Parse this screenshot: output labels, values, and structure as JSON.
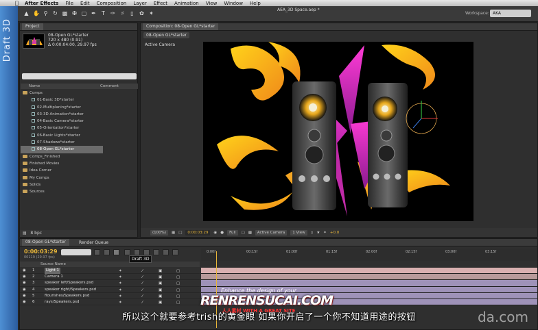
{
  "menubar": {
    "items": [
      "After Effects",
      "File",
      "Edit",
      "Composition",
      "Layer",
      "Effect",
      "Animation",
      "View",
      "Window",
      "Help"
    ]
  },
  "side_strip": {
    "label": "Draft 3D"
  },
  "toolbar": {
    "file_title": "AEA_3D Space.aep *",
    "workspace_label": "Workspace:",
    "workspace_value": "AKA"
  },
  "project": {
    "tab_label": "Project",
    "comp_name": "08-Open GL*starter",
    "info_lines": [
      "720 x 480 (0.91)",
      "Δ 0:00:04:00, 29.97 fps"
    ],
    "col_name": "Name",
    "col_comment": "Comment",
    "tree": [
      {
        "label": "Comps",
        "kind": "folder"
      },
      {
        "label": "01-Basic 3D*starter",
        "kind": "comp"
      },
      {
        "label": "02-Multiplaning*starter",
        "kind": "comp"
      },
      {
        "label": "03-3D Animation*starter",
        "kind": "comp"
      },
      {
        "label": "04-Basic Camera*starter",
        "kind": "comp"
      },
      {
        "label": "05-Orientation*starter",
        "kind": "comp"
      },
      {
        "label": "06-Basic Lights*starter",
        "kind": "comp"
      },
      {
        "label": "07-Shadows*starter",
        "kind": "comp"
      },
      {
        "label": "08-Open GL*starter",
        "kind": "comp",
        "selected": true
      },
      {
        "label": "Comps_Finished",
        "kind": "folder"
      },
      {
        "label": "Finished Movies",
        "kind": "folder"
      },
      {
        "label": "Idea Corner",
        "kind": "folder"
      },
      {
        "label": "My Comps",
        "kind": "folder"
      },
      {
        "label": "Solids",
        "kind": "folder"
      },
      {
        "label": "Sources",
        "kind": "folder"
      }
    ],
    "footer_bpc": "8 bpc"
  },
  "composition": {
    "tab_label": "Composition: 08-Open GL*starter",
    "crumb": "08-Open GL*starter",
    "view_label": "Active Camera",
    "footer": {
      "zoom": "(100%)",
      "time": "0:00:03:29",
      "resolution": "Full",
      "camera": "Active Camera",
      "views": "1 View",
      "exposure": "+0.0"
    }
  },
  "timeline": {
    "tab_label": "08-Open GL*starter",
    "render_queue_label": "Render Queue",
    "current_time": "0:00:03:29",
    "frames": "00119 (29.97 fps)",
    "tooltip": "Draft 3D",
    "source_name_header": "Source Name",
    "ruler": [
      "0:00f",
      "00:15f",
      "01:00f",
      "01:15f",
      "02:00f",
      "02:15f",
      "03:00f",
      "03:15f"
    ],
    "layers": [
      {
        "num": "1",
        "name": "Light 1",
        "selected": true
      },
      {
        "num": "2",
        "name": "Camera 1"
      },
      {
        "num": "3",
        "name": "speaker left/Speakers.psd"
      },
      {
        "num": "4",
        "name": "speaker right/Speakers.psd"
      },
      {
        "num": "5",
        "name": "flourishes/Speakers.psd"
      },
      {
        "num": "6",
        "name": "rays/Speakers.psd"
      }
    ],
    "bar_colors": [
      "#d9b0b0",
      "#b89a9a",
      "#9e92b8",
      "#9e92b8",
      "#9e92b8",
      "#9e92b8"
    ]
  },
  "overlay": {
    "brand_top": "Enhance the design of your",
    "brand_main": "RENRENSUCAI.COM",
    "brand_sub": "人人素材  WITH A GREAT SITE",
    "subtitle": "所以这个就要参考trish的黄金眼 如果你开启了一个你不知道用途的按钮",
    "watermark": "da.com"
  }
}
